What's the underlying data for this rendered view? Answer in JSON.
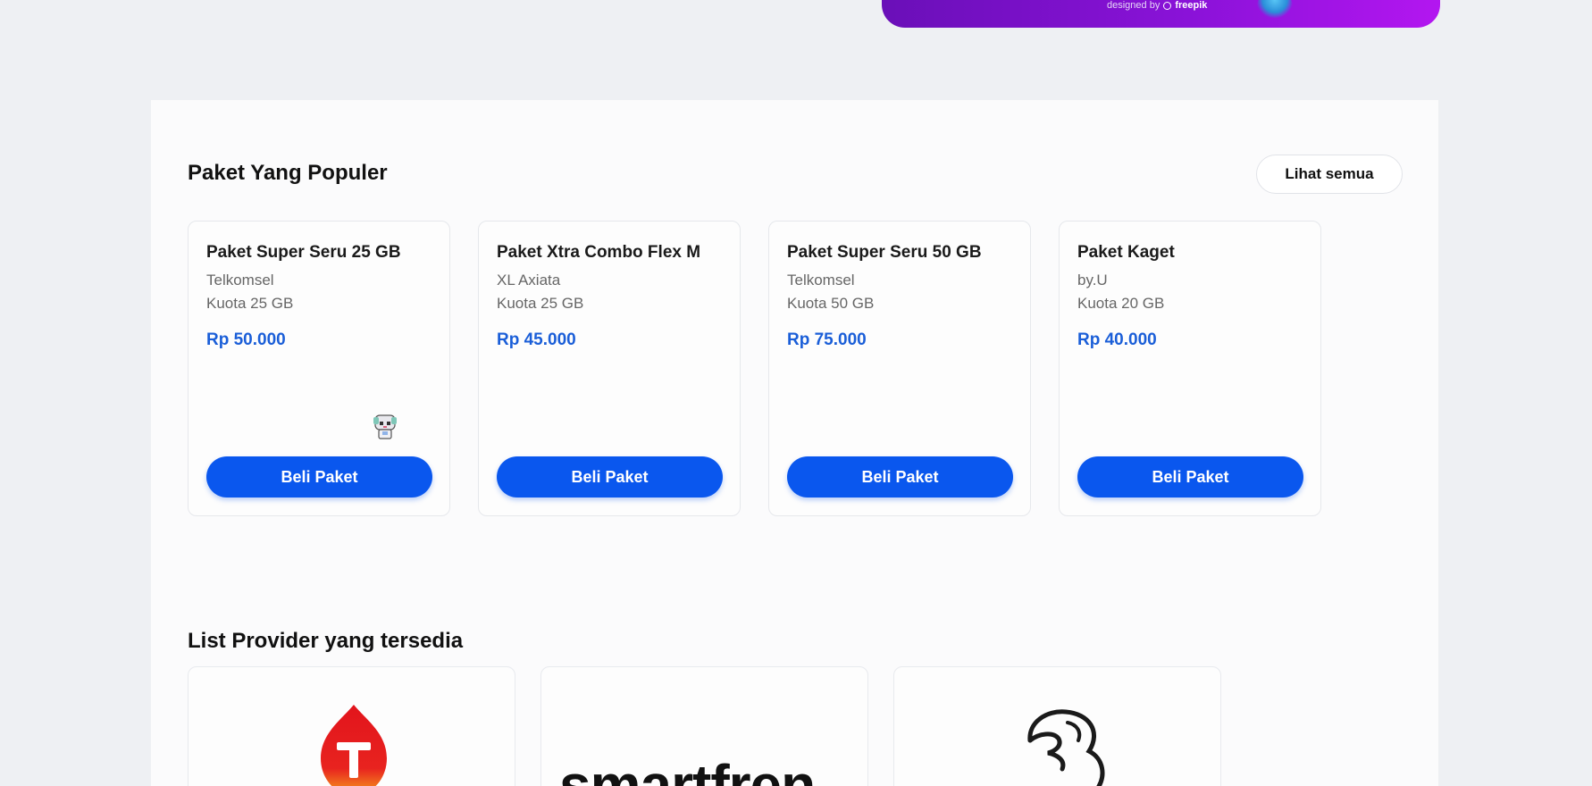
{
  "banner": {
    "credit_prefix": "designed by",
    "credit_brand": "freepik"
  },
  "popular": {
    "title": "Paket Yang Populer",
    "see_all_label": "Lihat semua",
    "cards": [
      {
        "name": "Paket Super Seru 25 GB",
        "provider": "Telkomsel",
        "quota": "Kuota 25 GB",
        "price": "Rp 50.000",
        "button": "Beli Paket"
      },
      {
        "name": "Paket Xtra Combo Flex M",
        "provider": "XL Axiata",
        "quota": "Kuota 25 GB",
        "price": "Rp 45.000",
        "button": "Beli Paket"
      },
      {
        "name": "Paket Super Seru 50 GB",
        "provider": "Telkomsel",
        "quota": "Kuota 50 GB",
        "price": "Rp 75.000",
        "button": "Beli Paket"
      },
      {
        "name": "Paket Kaget",
        "provider": "by.U",
        "quota": "Kuota 20 GB",
        "price": "Rp 40.000",
        "button": "Beli Paket"
      }
    ]
  },
  "providers": {
    "title": "List Provider yang tersedia",
    "logo_smartfren_text": "smartfren.",
    "items": [
      "telkomsel-logo",
      "smartfren-logo",
      "three-logo"
    ]
  },
  "colors": {
    "accent": "#0a57ee",
    "price": "#1a5ed8",
    "banner_start": "#6a0fb8",
    "banner_end": "#b316f0"
  }
}
